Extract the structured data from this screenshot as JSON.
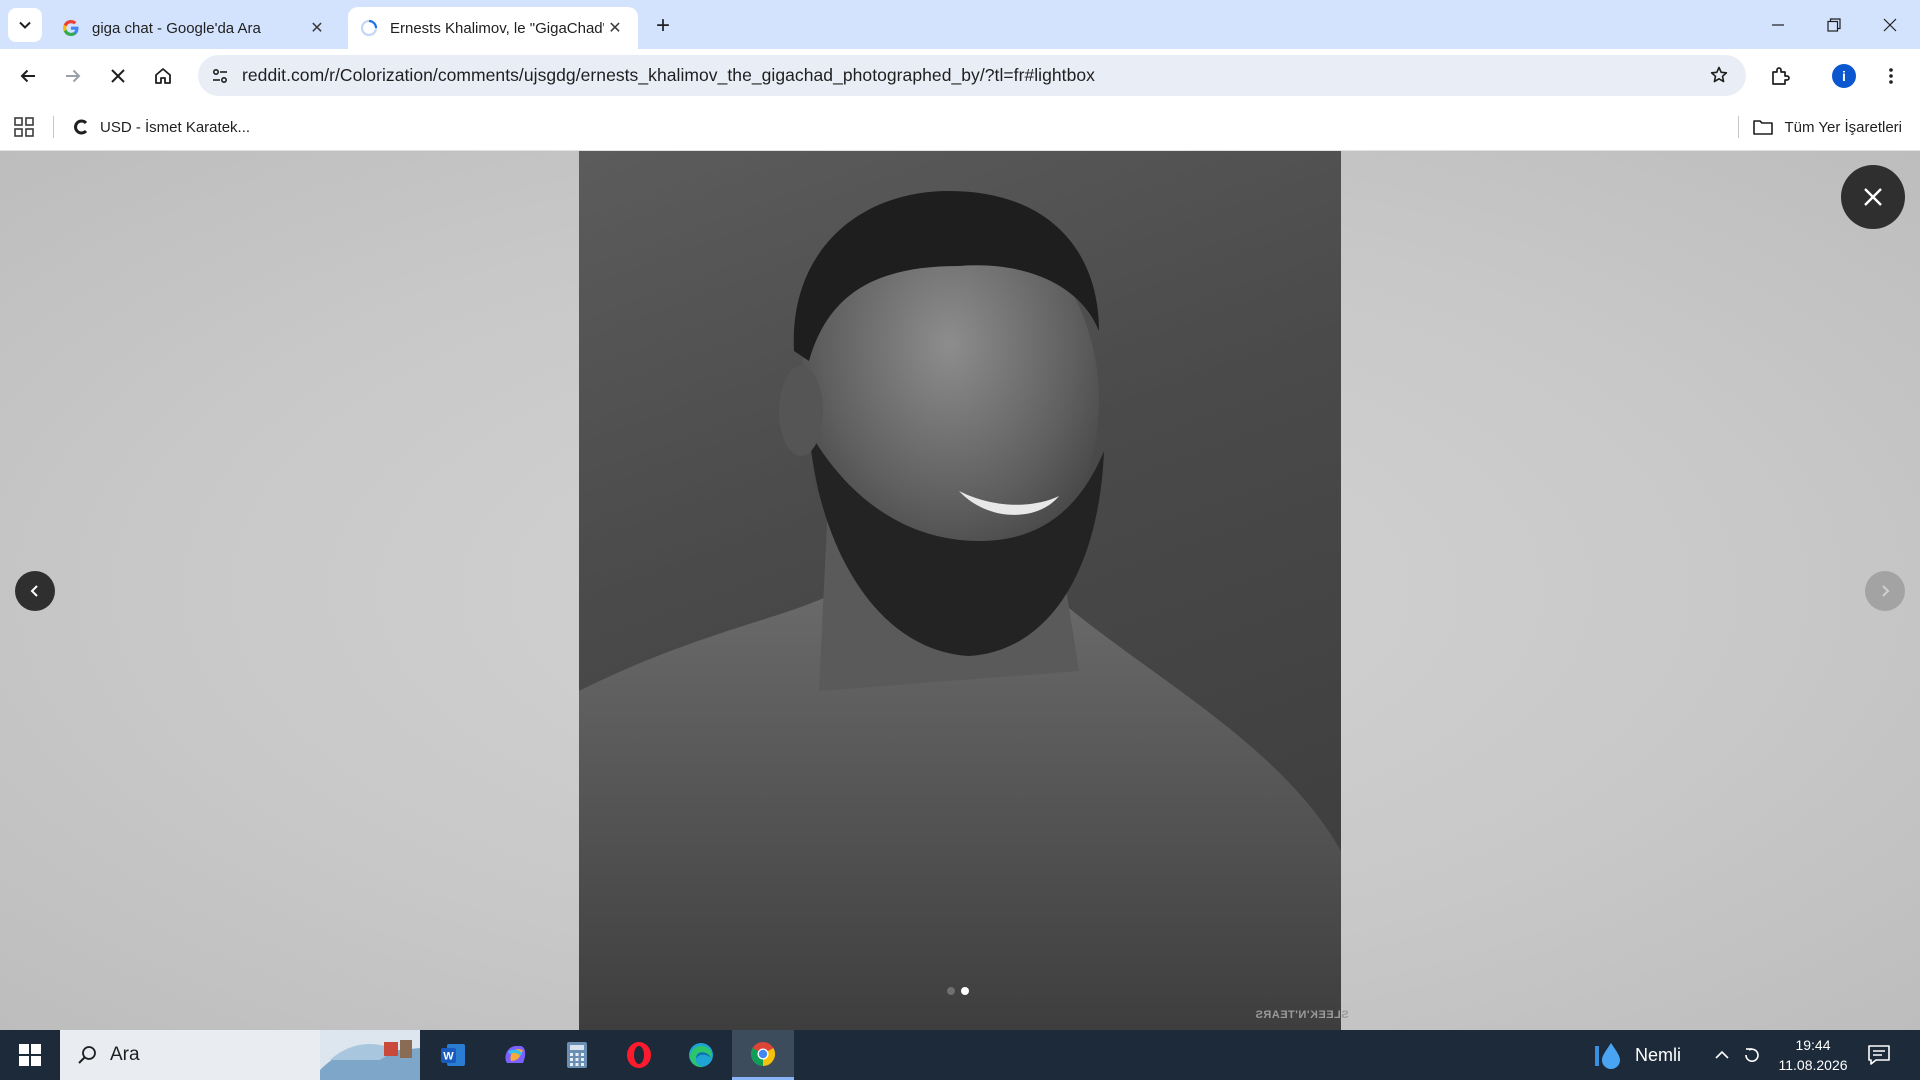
{
  "browser": {
    "tabs": [
      {
        "title": "giga chat - Google'da Ara",
        "favicon": "google-g-icon",
        "active": false
      },
      {
        "title": "Ernests Khalimov, le \"GigaChad\"",
        "favicon": "loading-spinner-icon",
        "active": true
      }
    ],
    "url": "reddit.com/r/Colorization/comments/ujsgdg/ernests_khalimov_the_gigachad_photographed_by/?tl=fr#lightbox",
    "profile_initial": "i",
    "bookmarks": [
      {
        "label": "USD - İsmet Karatek...",
        "icon": "bookmark-c-icon"
      }
    ],
    "all_bookmarks_label": "Tüm Yer İşaretleri"
  },
  "lightbox": {
    "image_alt": "Ernests Khalimov black and white portrait",
    "watermark": "SLEEK'N'TEARS",
    "slide_count": 2,
    "active_slide": 2
  },
  "taskbar": {
    "search_placeholder": "Ara",
    "apps": [
      "word-icon",
      "copilot-icon",
      "calculator-icon",
      "opera-icon",
      "edge-icon",
      "chrome-icon"
    ],
    "weather": "Nemli",
    "time": "19:44",
    "date": "11.08.2026"
  },
  "colors": {
    "tabstrip": "#d3e3fd",
    "omnibox": "#e9eef6",
    "profile": "#0b57d0",
    "taskbar": "#1c2a3a"
  }
}
